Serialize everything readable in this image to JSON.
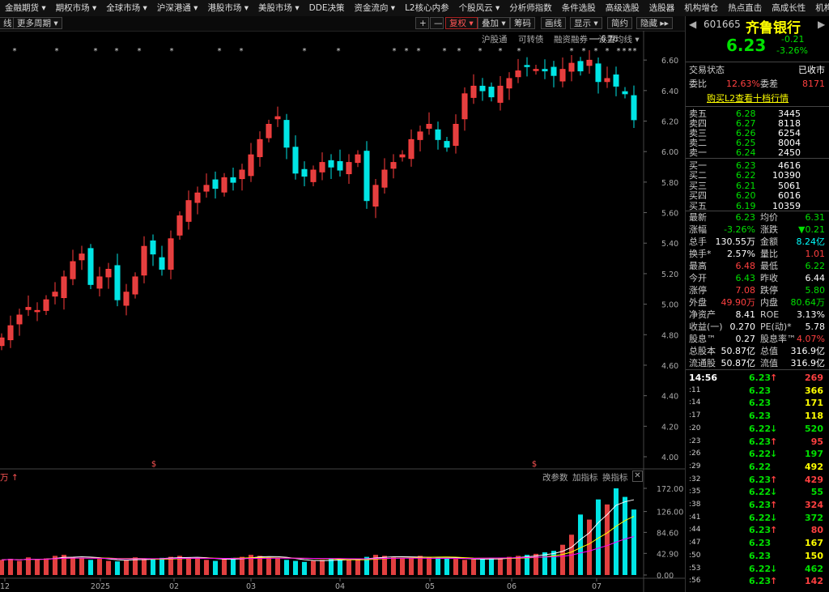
{
  "menu": [
    "金融期货 ▾",
    "期权市场 ▾",
    "全球市场 ▾",
    "沪深港通 ▾",
    "港股市场 ▾",
    "美股市场 ▾",
    "DDE决策",
    "资金流向 ▾",
    "L2核心内参",
    "个股风云 ▾",
    "分析师指数",
    "条件选股",
    "高级选股",
    "选股器",
    "机构增仓",
    "热点直击",
    "高成长性",
    "机构"
  ],
  "toolbar": {
    "line_label": "线",
    "period": "更多周期 ▾",
    "plus": "+",
    "minus": "—",
    "fuquan": "复权 ▾",
    "overlay": "叠加 ▾",
    "chips": "筹码",
    "draw": "画线",
    "display": "显示 ▾",
    "simple": "简约",
    "hide": "隐藏 ▸▸"
  },
  "sublinks": {
    "hgt": "沪股通",
    "kzz": "可转债",
    "rzrq": "融资融券",
    "ma": "设置均线 ▾"
  },
  "chart": {
    "high_label": "6.76",
    "price_ticks": [
      "6.60",
      "6.40",
      "6.20",
      "6.00",
      "5.80",
      "5.60",
      "5.40",
      "5.20",
      "5.00",
      "4.80",
      "4.60",
      "4.40",
      "4.20",
      "4.00"
    ],
    "vol_ticks": [
      "172.00",
      "126.00",
      "84.60",
      "42.90",
      "0.00"
    ],
    "x_labels": [
      "12",
      "2025",
      "02",
      "03",
      "04",
      "05",
      "06",
      "07"
    ],
    "vol_header": {
      "left": "万 ↑",
      "change": "改参数",
      "add": "加指标",
      "swap": "换指标",
      "close": "✕"
    },
    "dollar": "$",
    "star": "*"
  },
  "panel": {
    "code": "601665",
    "name": "齐鲁银行",
    "price": "6.23",
    "change": "-0.21",
    "pct": "-3.26%",
    "status_label": "交易状态",
    "status": "已收市",
    "weibi_label": "委比",
    "weibi": "12.63%",
    "weicha_label": "委差",
    "weicha": "8171",
    "l2_link": "购买L2查看十档行情",
    "asks": [
      [
        "卖五",
        "6.28",
        "3445"
      ],
      [
        "卖四",
        "6.27",
        "8118"
      ],
      [
        "卖三",
        "6.26",
        "6254"
      ],
      [
        "卖二",
        "6.25",
        "8004"
      ],
      [
        "卖一",
        "6.24",
        "2450"
      ]
    ],
    "bids": [
      [
        "买一",
        "6.23",
        "4616"
      ],
      [
        "买二",
        "6.22",
        "10390"
      ],
      [
        "买三",
        "6.21",
        "5061"
      ],
      [
        "买四",
        "6.20",
        "6016"
      ],
      [
        "买五",
        "6.19",
        "10359"
      ]
    ],
    "stats": [
      [
        "最新",
        "6.23",
        "均价",
        "6.31"
      ],
      [
        "涨幅",
        "-3.26%",
        "涨跌",
        "▼0.21"
      ],
      [
        "总手",
        "130.55万",
        "金额",
        "8.24亿"
      ],
      [
        "换手*",
        "2.57%",
        "量比",
        "1.01"
      ],
      [
        "最高",
        "6.48",
        "最低",
        "6.22"
      ],
      [
        "今开",
        "6.43",
        "昨收",
        "6.44"
      ],
      [
        "涨停",
        "7.08",
        "跌停",
        "5.80"
      ],
      [
        "外盘",
        "49.90万",
        "内盘",
        "80.64万"
      ],
      [
        "净资产",
        "8.41",
        "ROE",
        "3.13%"
      ],
      [
        "收益(一)",
        "0.270",
        "PE(动)*",
        "5.78"
      ],
      [
        "股息™",
        "0.27",
        "股息率™",
        "4.07%"
      ],
      [
        "总股本",
        "50.87亿",
        "总值",
        "316.9亿"
      ],
      [
        "流通股",
        "50.87亿",
        "流值",
        "316.9亿"
      ]
    ],
    "ticks": [
      [
        "14:56",
        "6.23",
        "↑",
        "269"
      ],
      [
        ":11",
        "6.23",
        "",
        "366"
      ],
      [
        ":14",
        "6.23",
        "",
        "171"
      ],
      [
        ":17",
        "6.23",
        "",
        "118"
      ],
      [
        ":20",
        "6.22",
        "↓",
        "520"
      ],
      [
        ":23",
        "6.23",
        "↑",
        "95"
      ],
      [
        ":26",
        "6.22",
        "↓",
        "197"
      ],
      [
        ":29",
        "6.22",
        "",
        "492"
      ],
      [
        ":32",
        "6.23",
        "↑",
        "429"
      ],
      [
        ":35",
        "6.22",
        "↓",
        "55"
      ],
      [
        ":38",
        "6.23",
        "↑",
        "324"
      ],
      [
        ":41",
        "6.22",
        "↓",
        "372"
      ],
      [
        ":44",
        "6.23",
        "↑",
        "80"
      ],
      [
        ":47",
        "6.23",
        "",
        "167"
      ],
      [
        ":50",
        "6.23",
        "",
        "150"
      ],
      [
        ":53",
        "6.22",
        "↓",
        "462"
      ],
      [
        ":56",
        "6.23",
        "↑",
        "142"
      ]
    ]
  },
  "chart_data": {
    "type": "candlestick",
    "x_labels": [
      "12",
      "2025",
      "02",
      "03",
      "04",
      "05",
      "06",
      "07"
    ],
    "ylim": [
      4.0,
      6.76
    ],
    "price_axis": [
      4.0,
      4.2,
      4.4,
      4.6,
      4.8,
      5.0,
      5.2,
      5.4,
      5.6,
      5.8,
      6.0,
      6.2,
      6.4,
      6.6
    ],
    "vol_axis": [
      0,
      42.9,
      84.6,
      126,
      172
    ],
    "closes": [
      4.8,
      4.88,
      4.95,
      5.0,
      4.98,
      5.05,
      5.1,
      5.2,
      5.3,
      5.35,
      5.15,
      5.2,
      5.25,
      5.05,
      5.1,
      5.2,
      5.4,
      5.35,
      5.25,
      5.45,
      5.6,
      5.7,
      5.75,
      5.8,
      5.78,
      5.85,
      5.82,
      5.9,
      6.0,
      6.1,
      6.2,
      6.25,
      6.05,
      5.88,
      5.86,
      5.9,
      5.95,
      5.92,
      5.9,
      5.95,
      6.0,
      5.7,
      5.8,
      5.9,
      5.95,
      6.0,
      6.1,
      6.15,
      6.2,
      6.1,
      6.05,
      6.2,
      6.4,
      6.45,
      6.42,
      6.38,
      6.45,
      6.5,
      6.55,
      6.58,
      6.56,
      6.55,
      6.52,
      6.56,
      6.6,
      6.55,
      6.62,
      6.48,
      6.5,
      6.45,
      6.4,
      6.23
    ],
    "volumes": [
      30,
      32,
      28,
      35,
      30,
      33,
      38,
      40,
      36,
      34,
      30,
      32,
      28,
      27,
      30,
      35,
      33,
      31,
      34,
      36,
      38,
      35,
      33,
      30,
      28,
      32,
      34,
      36,
      40,
      38,
      35,
      33,
      30,
      28,
      26,
      28,
      30,
      33,
      31,
      30,
      32,
      36,
      40,
      38,
      35,
      33,
      34,
      38,
      36,
      34,
      33,
      32,
      30,
      31,
      32,
      34,
      33,
      36,
      38,
      40,
      42,
      45,
      48,
      60,
      80,
      120,
      110,
      150,
      140,
      172,
      155,
      130
    ]
  }
}
